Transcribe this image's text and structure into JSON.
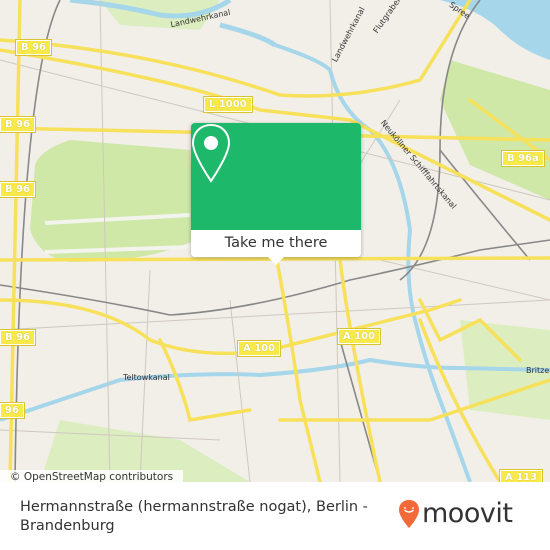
{
  "map": {
    "attribution": "© OpenStreetMap contributors",
    "colors": {
      "land": "#f2efe9",
      "park": "#cfe8a8",
      "water": "#a6d6ea",
      "major_road": "#f7e05a",
      "accent_green": "#1db86a",
      "brand_orange": "#f26a3a"
    },
    "road_shields": [
      {
        "id": "b96-1",
        "label": "B 96"
      },
      {
        "id": "b96-2",
        "label": "B 96"
      },
      {
        "id": "b96-3",
        "label": "B 96"
      },
      {
        "id": "b96-4",
        "label": "B 96"
      },
      {
        "id": "b96-5",
        "label": "96"
      },
      {
        "id": "l1000",
        "label": "L 1000"
      },
      {
        "id": "b96a",
        "label": "B 96a"
      },
      {
        "id": "a100-1",
        "label": "A 100"
      },
      {
        "id": "a100-2",
        "label": "A 100"
      },
      {
        "id": "a113",
        "label": "A 113"
      }
    ],
    "labels": {
      "landwehrkanal_1": "Landwehrkanal",
      "landwehrkanal_2": "Landwehrkanal",
      "flutgraben": "Flutgraben",
      "spree": "Spree",
      "neukoellner": "Neuköllner Schifffahrtskanal",
      "teltowkanal": "Teltowkanal",
      "britzer": "Britzer"
    }
  },
  "popup": {
    "icon": "map-pin-icon",
    "button_label": "Take me there"
  },
  "footer": {
    "place_name": "Hermannstraße (hermannstraße nogat), Berlin - Brandenburg",
    "logo_text": "moovit"
  }
}
